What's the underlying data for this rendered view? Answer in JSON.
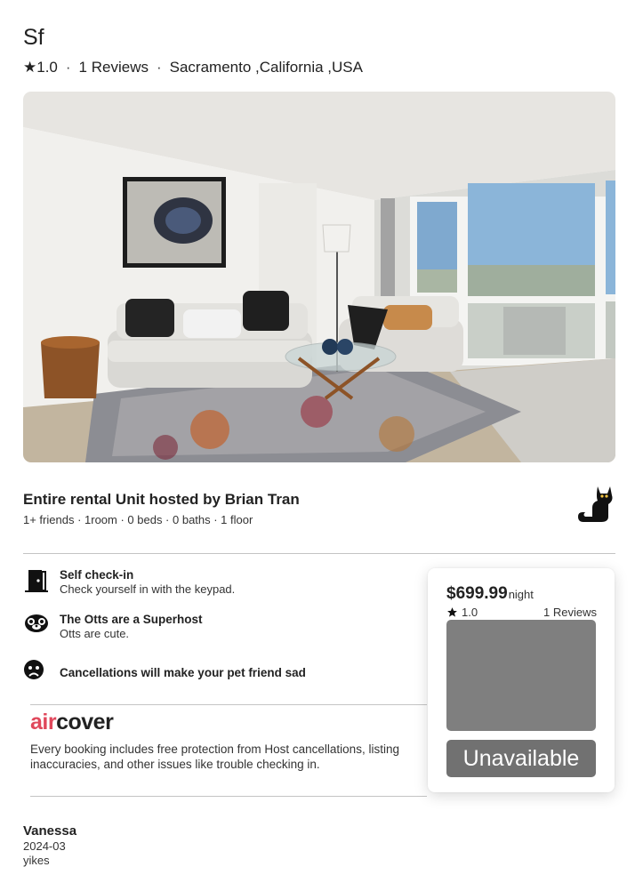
{
  "listing": {
    "title": "Sf",
    "rating": "★1.0",
    "reviews_count": "1 Reviews",
    "location": "Sacramento ,California ,USA"
  },
  "host": {
    "heading": "Entire rental Unit hosted by Brian Tran",
    "details": "1+ friends · 1room · 0 beds · 0 baths · 1 floor",
    "avatar_icon": "black-cat-icon"
  },
  "features": [
    {
      "icon": "door-icon",
      "title": "Self check-in",
      "description": "Check yourself in with the keypad."
    },
    {
      "icon": "otter-icon",
      "title": "The Otts are a Superhost",
      "description": "Otts are cute."
    },
    {
      "icon": "sad-face-icon",
      "title": "Cancellations will make your pet friend sad",
      "description": ""
    }
  ],
  "aircover": {
    "logo_air": "air",
    "logo_cover": "cover",
    "text": "Every booking includes free protection from Host cancellations, listing inaccuracies, and other issues like trouble checking in.",
    "brand_color": "#e0475b"
  },
  "booking": {
    "price": "$699.99",
    "unit": "night",
    "rating": "1.0",
    "reviews": "1 Reviews",
    "button_label": "Unavailable"
  },
  "review": {
    "name": "Vanessa",
    "date": "2024-03",
    "text": "yikes"
  }
}
